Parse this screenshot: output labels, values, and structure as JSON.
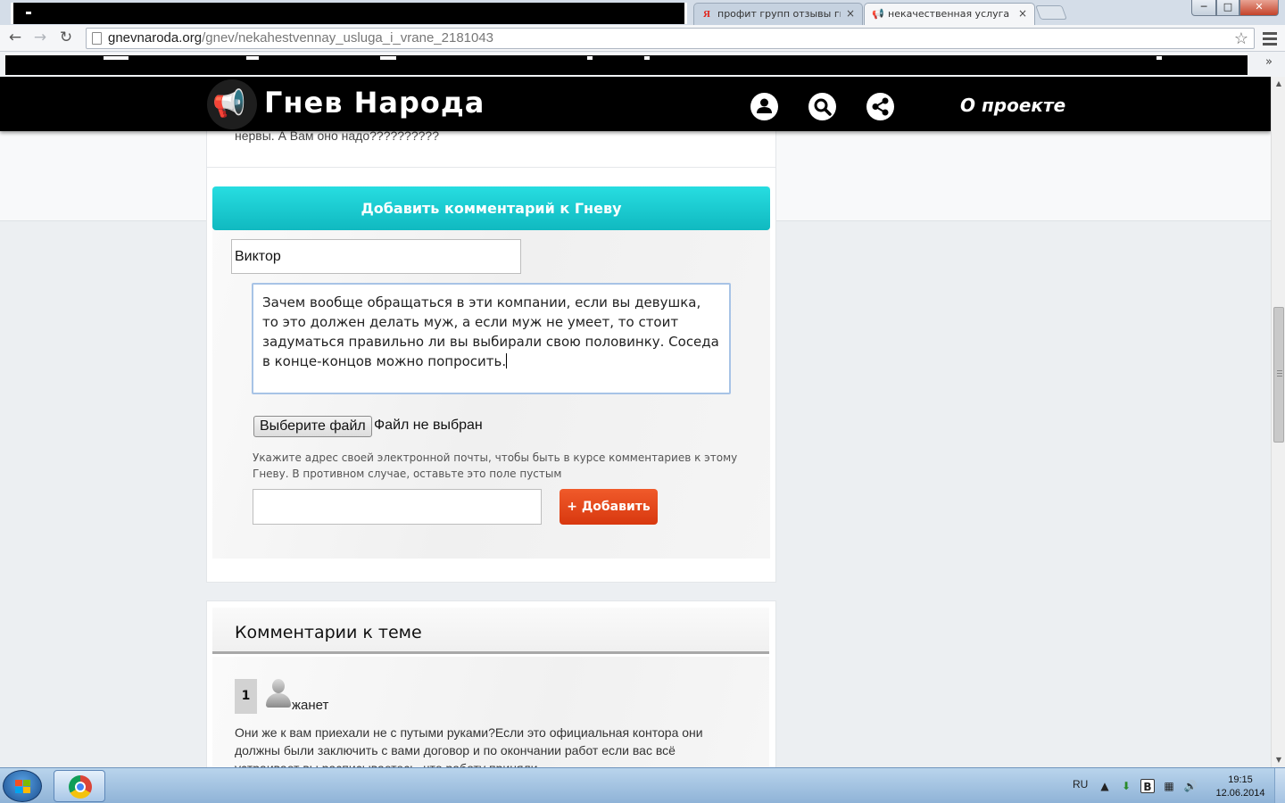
{
  "browser": {
    "tabs": [
      {
        "title": "профит групп отзывы гн",
        "favicon": "yandex-icon",
        "close": "×",
        "fav_glyph": "Я"
      },
      {
        "title": "некачественная услуга и",
        "favicon": "megaphone-icon",
        "close": "×",
        "fav_glyph": "📢"
      }
    ],
    "url_host": "gnevnaroda.org",
    "url_path": "/gnev/nekahestvennay_usluga_i_vrane_2181043",
    "window_controls": {
      "minimize": "─",
      "maximize": "□",
      "close": "✕"
    },
    "nav": {
      "back": "←",
      "forward": "→",
      "reload": "↻",
      "star": "☆"
    },
    "bookmarks_overflow": "»"
  },
  "site": {
    "brand": "Гнев Народа",
    "nav_about": "О проекте",
    "icons": {
      "user": "user-icon",
      "search": "search-icon",
      "share": "share-icon"
    }
  },
  "post": {
    "tail_text": "нервы. А Вам оно надо??????????"
  },
  "form": {
    "header": "Добавить комментарий к Гневу",
    "name_value": "Виктор",
    "comment_value": "Зачем вообще обращаться в эти компании, если вы девушка, то это должен делать муж, а если муж не умеет, то стоит задуматься правильно ли вы выбирали свою половинку. Соседа в конце-концов можно попросить.",
    "file_button": "Выберите файл",
    "file_status": "Файл не выбран",
    "email_hint": "Укажите адрес своей электронной почты, чтобы быть в курсе комментариев к этому Гневу. В противном случае, оставьте это поле пустым",
    "email_value": "",
    "submit": "+ Добавить"
  },
  "comments": {
    "title": "Комментарии к теме",
    "items": [
      {
        "number": "1",
        "author": "жанет",
        "text": "Они же к вам приехали не с путыми руками?Если это официальная контора они должны были заключить с вами договор и по окончании работ если вас всё устраивает вы расписываетесь, что работу приняли"
      }
    ]
  },
  "taskbar": {
    "lang": "RU",
    "time": "19:15",
    "date": "12.06.2014"
  },
  "colors": {
    "accent_teal": "#1ccbd0",
    "button_orange": "#e3471a",
    "header_black": "#000000"
  }
}
